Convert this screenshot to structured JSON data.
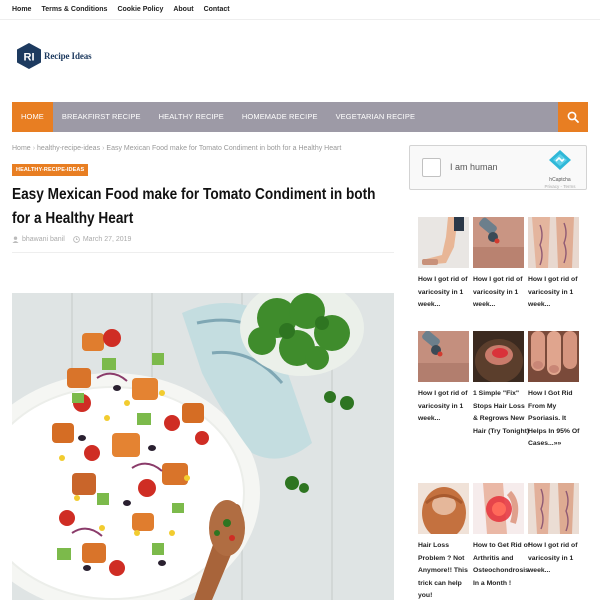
{
  "topbar": {
    "links": [
      "Home",
      "Terms & Conditions",
      "Cookie Policy",
      "About",
      "Contact"
    ]
  },
  "logo": {
    "mark": "RI",
    "text": "Recipe Ideas"
  },
  "nav": {
    "items": [
      "HOME",
      "BREAKFIRST RECIPE",
      "HEALTHY RECIPE",
      "HOMEMADE RECIPE",
      "VEGETARIAN RECIPE"
    ],
    "active_index": 0,
    "search_icon": "search-icon"
  },
  "breadcrumb": [
    "Home",
    "healthy-recipe-ideas",
    "Easy Mexican Food make for Tomato Condiment in both for a Healthy Heart"
  ],
  "article": {
    "category": "HEALTHY-RECIPE-IDEAS",
    "title": "Easy Mexican Food make for Tomato Condiment in both for a Healthy Heart",
    "author": "bhawani banil",
    "date": "March 27, 2019"
  },
  "captcha": {
    "label": "I am human",
    "brand": "hCaptcha",
    "links": "Privacy - Terms"
  },
  "ads": [
    {
      "caption": "How I got rid of varicosity in 1 week...",
      "image": "legs"
    },
    {
      "caption": "How I got rid of varicosity in 1 week...",
      "image": "device-skin"
    },
    {
      "caption": "How I got rid of varicosity in 1 week...",
      "image": "veins"
    },
    {
      "caption": "How I got rid of varicosity in 1 week...",
      "image": "device-skin"
    },
    {
      "caption": "1 Simple \"Fix\" Stops Hair Loss & Regrows New Hair (Try Tonight)",
      "image": "scalp"
    },
    {
      "caption": "How I Got Rid From My Psoriasis. It Helps In 95% Of Cases...»»",
      "image": "fingers"
    },
    {
      "caption": "Hair Loss Problem ? Not Anymore!! This trick can help you!",
      "image": "hair"
    },
    {
      "caption": "How to Get Rid of Arthritis and Osteochondrosis In a Month !",
      "image": "knee"
    },
    {
      "caption": "How I got rid of varicosity in 1 week...",
      "image": "veins"
    }
  ],
  "colors": {
    "accent": "#e87e22",
    "nav_bg": "#9d9aa6",
    "logo": "#1d3a5f"
  }
}
